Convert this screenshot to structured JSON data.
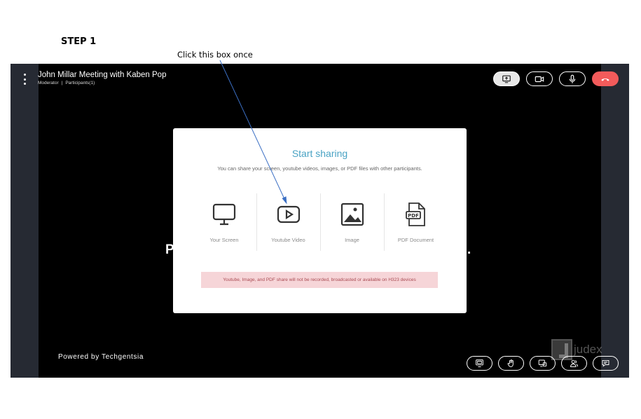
{
  "instructions": {
    "step": "STEP 1",
    "callout": "Click this box once"
  },
  "meeting": {
    "title": "John Millar Meeting with Kaben Pop",
    "role": "Moderator",
    "separator": "|",
    "participants": "Participants(1)",
    "background_left": "P",
    "background_right": "."
  },
  "modal": {
    "title": "Start sharing",
    "subtitle": "You can share your screen, youtube videos, images, or PDF files with other participants.",
    "options": [
      {
        "label": "Your Screen",
        "icon": "monitor-icon"
      },
      {
        "label": "Youtube Video",
        "icon": "play-icon"
      },
      {
        "label": "Image",
        "icon": "image-icon"
      },
      {
        "label": "PDF Document",
        "icon": "pdf-icon"
      }
    ],
    "notice": "Youtube, Image, and PDF share will not be recorded, broadcasted or available on H323 devices"
  },
  "footer": {
    "powered_by": "Powered by Techgentsia"
  },
  "watermark": {
    "text": "judex"
  },
  "colors": {
    "accent": "#4aa3c4",
    "end_call": "#f25b5b",
    "notice_bg": "#f6d5d8",
    "arrow": "#3b6fc4"
  }
}
